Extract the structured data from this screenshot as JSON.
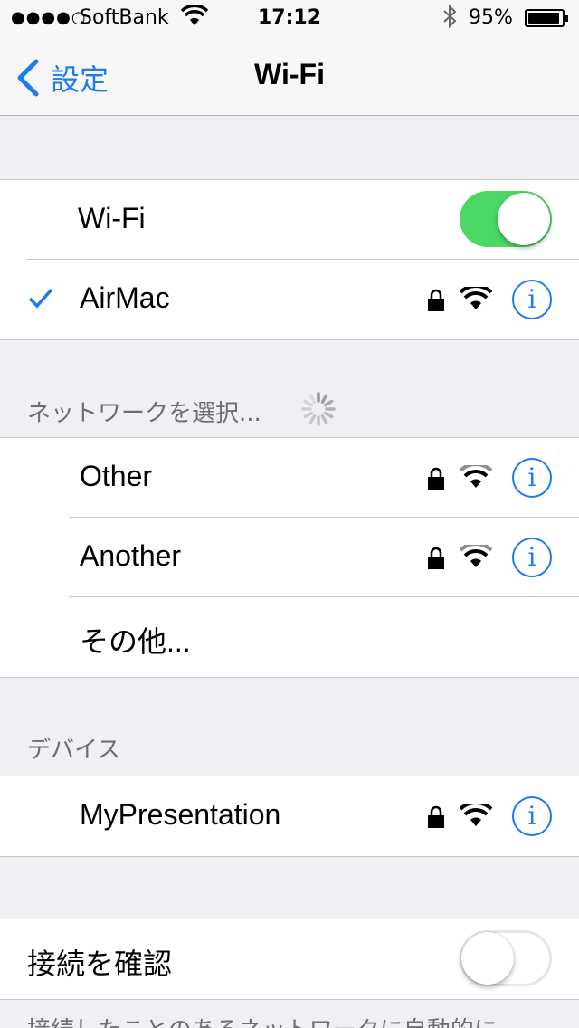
{
  "status_bar": {
    "signal": "●●●●○",
    "carrier": "SoftBank",
    "time": "17:12",
    "battery_percent": "95%",
    "battery_level": 0.95
  },
  "nav": {
    "back_label": "設定",
    "title": "Wi-Fi"
  },
  "wifi_group": {
    "toggle_label": "Wi-Fi",
    "toggle_on": true,
    "connected_network": "AirMac"
  },
  "network_section": {
    "header": "ネットワークを選択...",
    "networks": [
      {
        "name": "Other",
        "locked": true
      },
      {
        "name": "Another",
        "locked": true
      }
    ],
    "other_label": "その他..."
  },
  "devices_section": {
    "header": "デバイス",
    "devices": [
      {
        "name": "MyPresentation",
        "locked": true
      }
    ]
  },
  "ask_group": {
    "label": "接続を確認",
    "toggle_on": false,
    "footer": "接続したことのあるネットワークに自動的に"
  },
  "colors": {
    "accent": "#1a7cf1",
    "toggle_on": "#4cd864",
    "background": "#efeff4"
  },
  "icons": [
    "back-chevron-icon",
    "wifi-icon",
    "bluetooth-icon",
    "battery-icon",
    "checkmark-icon",
    "lock-icon",
    "info-icon",
    "spinner-icon"
  ]
}
